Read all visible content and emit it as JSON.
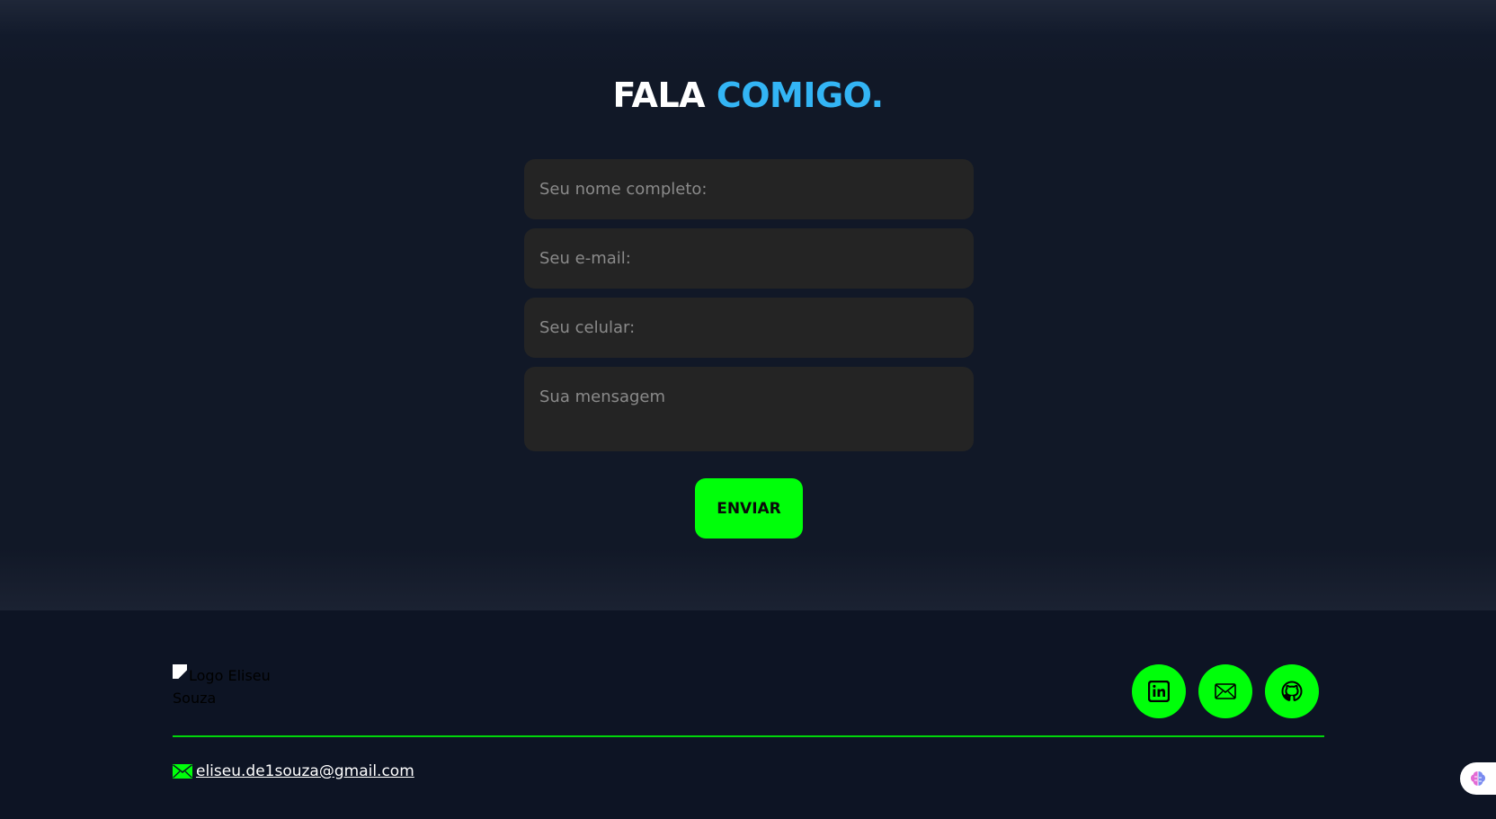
{
  "contact": {
    "title_white": "FALA",
    "title_accent": "COMIGO.",
    "fields": {
      "name_placeholder": "Seu nome completo:",
      "email_placeholder": "Seu e-mail:",
      "phone_placeholder": "Seu celular:",
      "message_placeholder": "Sua mensagem"
    },
    "submit_label": "ENVIAR"
  },
  "footer": {
    "logo_alt": "Logo Eliseu Souza",
    "social": [
      {
        "icon": "linkedin-icon"
      },
      {
        "icon": "mail-icon"
      },
      {
        "icon": "github-icon"
      }
    ],
    "email": "eliseu.de1souza@gmail.com"
  },
  "colors": {
    "background": "#111827",
    "accent_blue": "#33b5f5",
    "accent_green": "#00ff0a",
    "field_bg": "#242424"
  }
}
